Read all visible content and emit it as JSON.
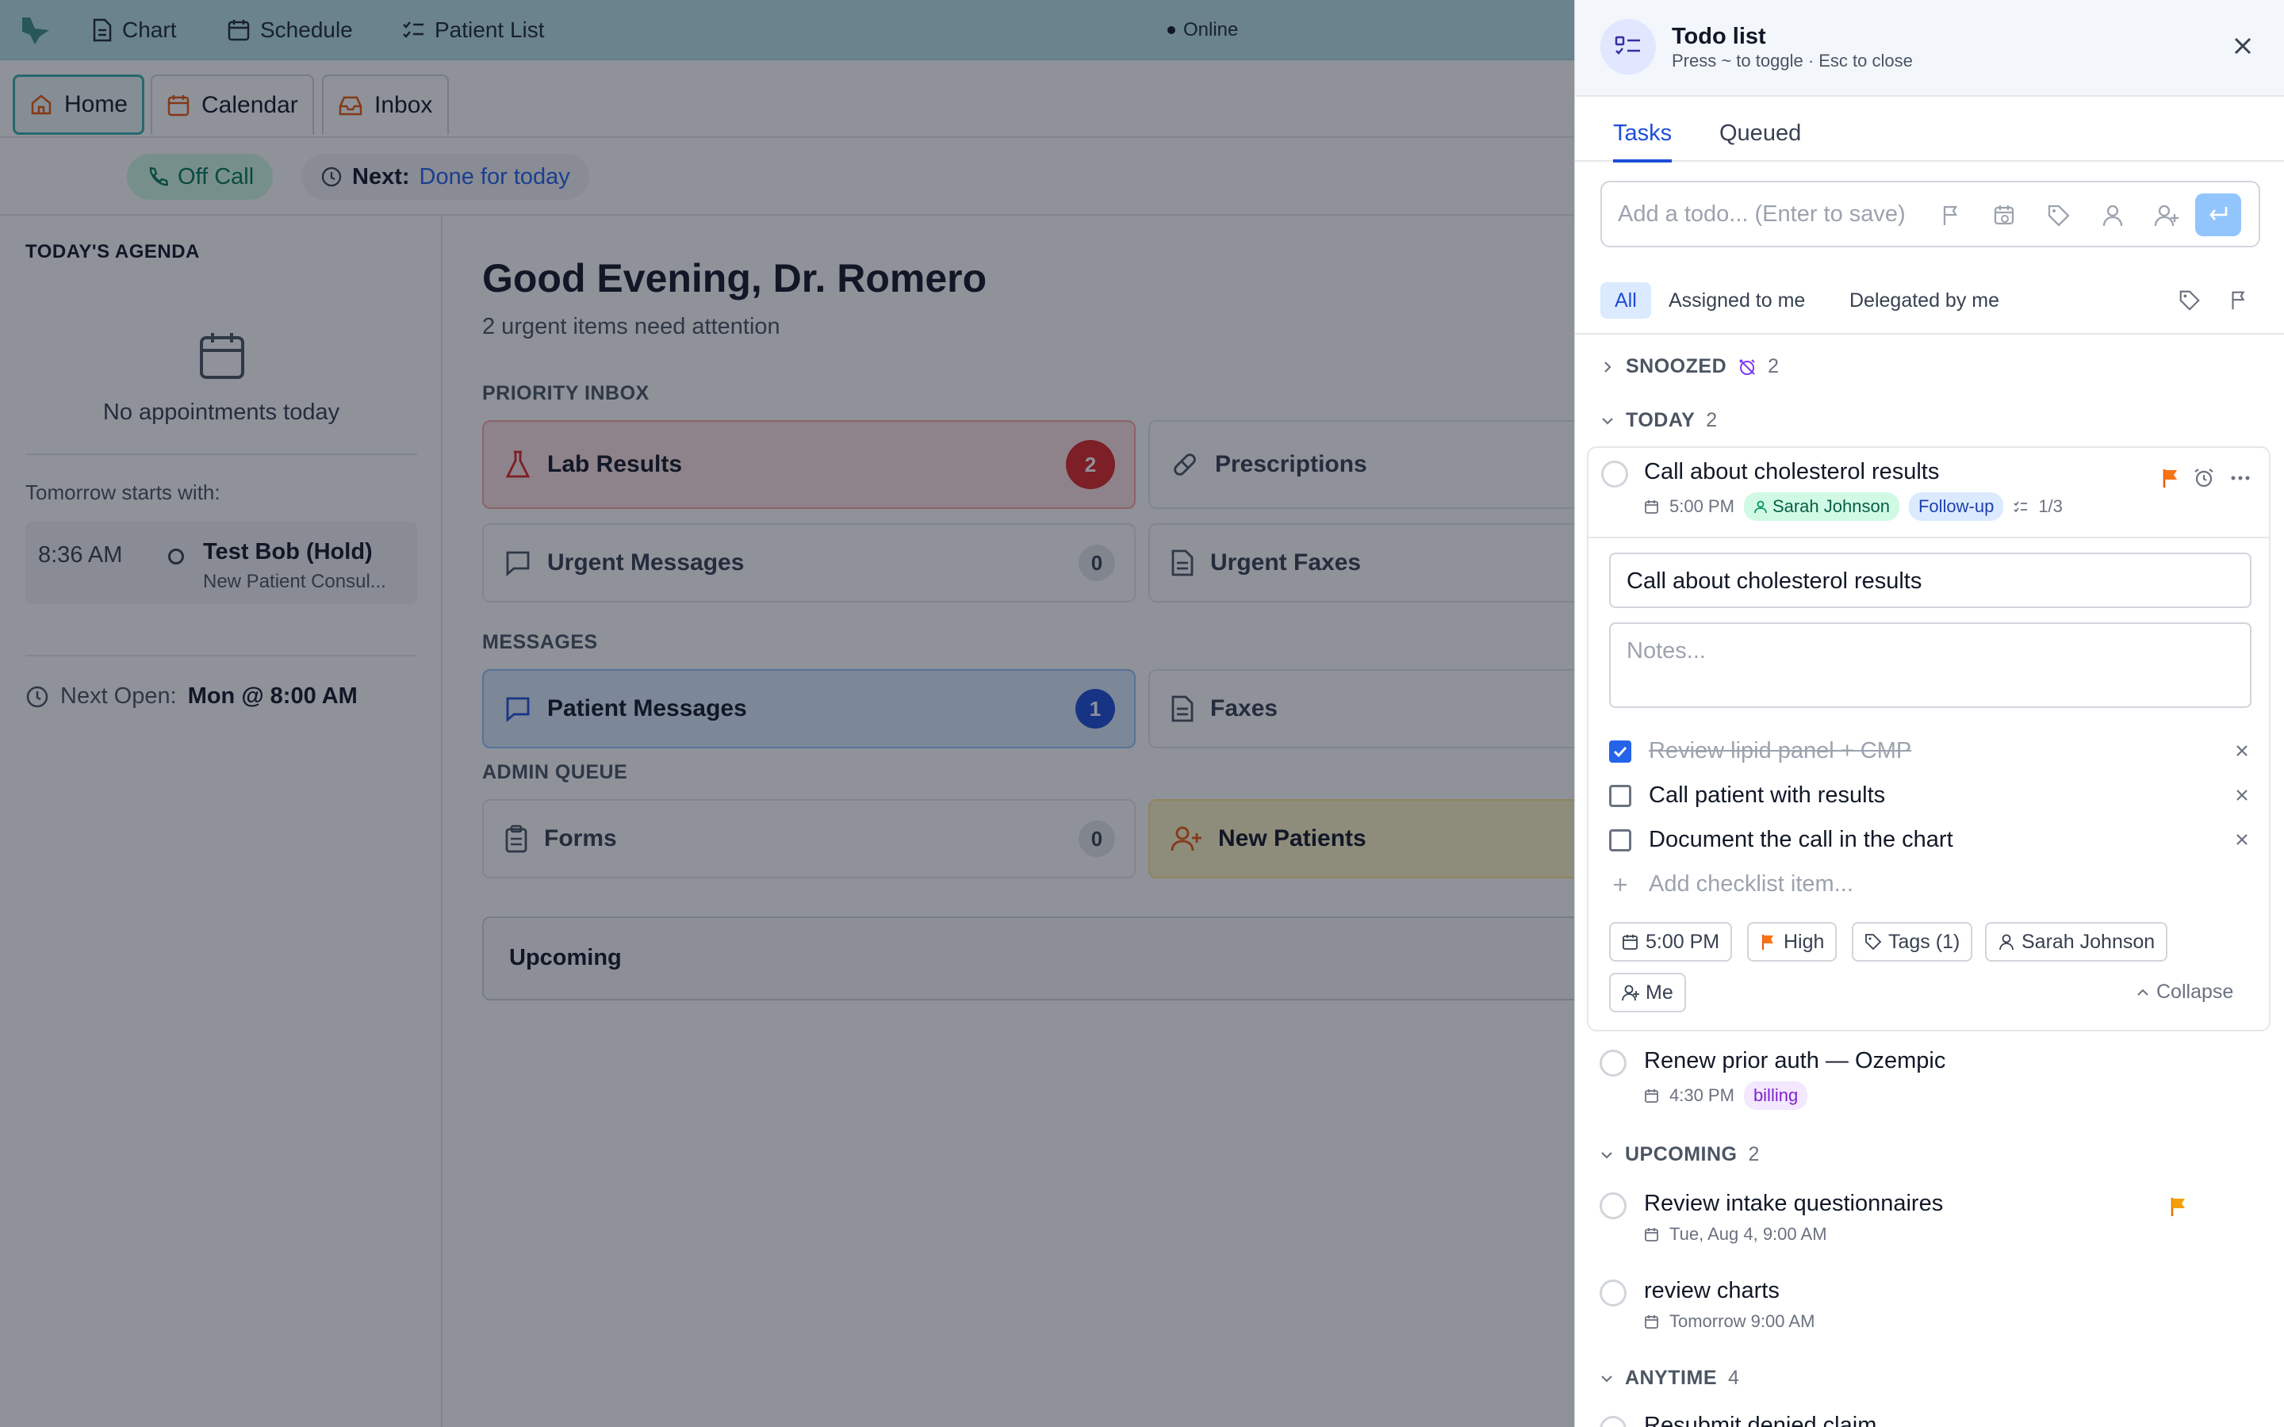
{
  "topbar": {
    "nav": [
      {
        "icon": "document-icon",
        "label": "Chart"
      },
      {
        "icon": "calendar-icon",
        "label": "Schedule"
      },
      {
        "icon": "list-check-icon",
        "label": "Patient List"
      }
    ],
    "status": "Online"
  },
  "tabs": [
    {
      "icon": "home-icon",
      "label": "Home",
      "active": true
    },
    {
      "icon": "calendar-icon",
      "label": "Calendar",
      "active": false
    },
    {
      "icon": "inbox-icon",
      "label": "Inbox",
      "active": false
    }
  ],
  "status_bar": {
    "call_status": "Off Call",
    "next_label": "Next:",
    "next_value": "Done for today"
  },
  "sidebar": {
    "title": "TODAY'S AGENDA",
    "empty_text": "No appointments today",
    "tomorrow_label": "Tomorrow starts with:",
    "appointment": {
      "time": "8:36 AM",
      "name": "Test Bob (Hold)",
      "type": "New Patient Consul..."
    },
    "next_open_label": "Next Open:",
    "next_open_value": "Mon @ 8:00 AM"
  },
  "main": {
    "greeting": "Good Evening, Dr. Romero",
    "subtitle": "2 urgent items need attention",
    "sections": {
      "priority": "PRIORITY INBOX",
      "messages": "MESSAGES",
      "admin": "ADMIN QUEUE"
    },
    "cards": {
      "lab_results": {
        "label": "Lab Results",
        "count": "2"
      },
      "prescriptions": {
        "label": "Prescriptions"
      },
      "urgent_messages": {
        "label": "Urgent Messages",
        "count": "0"
      },
      "urgent_faxes": {
        "label": "Urgent Faxes"
      },
      "patient_messages": {
        "label": "Patient Messages",
        "count": "1"
      },
      "faxes": {
        "label": "Faxes"
      },
      "forms": {
        "label": "Forms",
        "count": "0"
      },
      "new_patients": {
        "label": "New Patients"
      }
    },
    "upcoming": "Upcoming"
  },
  "todo": {
    "title": "Todo list",
    "hint": "Press ~ to toggle · Esc to close",
    "tabs": [
      "Tasks",
      "Queued"
    ],
    "add_placeholder": "Add a todo... (Enter to save)",
    "filters": [
      "All",
      "Assigned to me",
      "Delegated by me"
    ],
    "groups": {
      "snoozed": {
        "label": "SNOOZED",
        "count": "2"
      },
      "today": {
        "label": "TODAY",
        "count": "2"
      },
      "upcoming": {
        "label": "UPCOMING",
        "count": "2"
      },
      "anytime": {
        "label": "ANYTIME",
        "count": "4"
      }
    },
    "expanded_task": {
      "title": "Call about cholesterol results",
      "time": "5:00 PM",
      "assignee": "Sarah Johnson",
      "tag": "Follow-up",
      "progress": "1/3",
      "title_field": "Call about cholesterol results",
      "notes_placeholder": "Notes...",
      "checklist": [
        {
          "text": "Review lipid panel + CMP",
          "done": true
        },
        {
          "text": "Call patient with results",
          "done": false
        },
        {
          "text": "Document the call in the chart",
          "done": false
        }
      ],
      "add_checklist": "Add checklist item...",
      "chips": {
        "time": "5:00 PM",
        "priority": "High",
        "tags": "Tags (1)",
        "assignee": "Sarah Johnson",
        "delegate": "Me",
        "collapse": "Collapse"
      }
    },
    "tasks": [
      {
        "title": "Renew prior auth — Ozempic",
        "time": "4:30 PM",
        "tag": "billing"
      },
      {
        "title": "Review intake questionnaires",
        "time": "Tue, Aug 4, 9:00 AM"
      },
      {
        "title": "review charts",
        "time": "Tomorrow 9:00 AM"
      },
      {
        "title": "Resubmit denied claim"
      }
    ]
  },
  "colors": {
    "accent": "#1d4ed8",
    "topbar": "#b9e3e6",
    "flag_orange": "#f97316",
    "flag_amber": "#f59e0b",
    "danger": "#dc2626",
    "success": "#047857"
  }
}
